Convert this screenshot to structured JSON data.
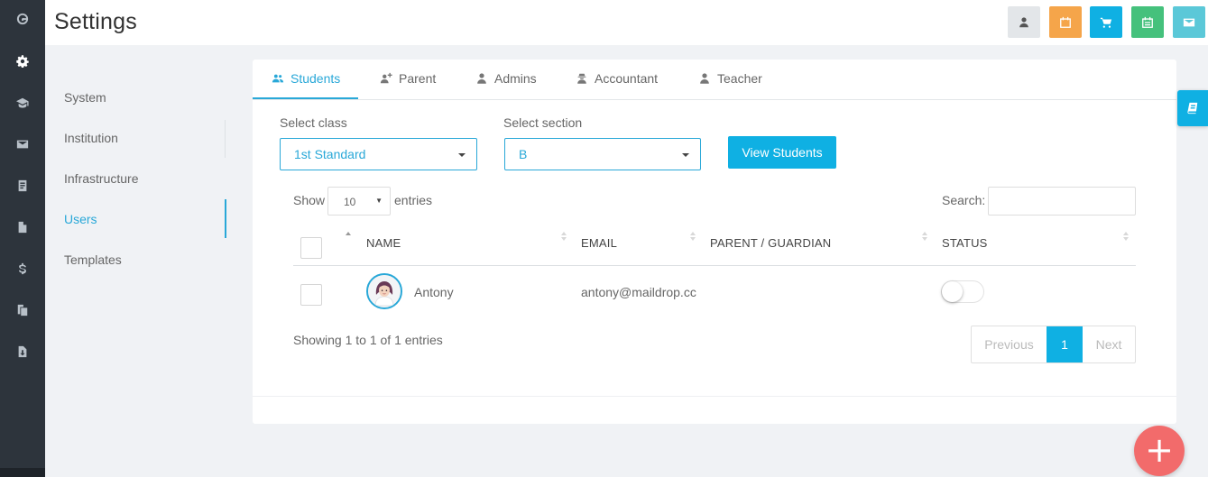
{
  "app": {
    "title": "Settings"
  },
  "rail": {
    "icons": [
      "dashboard-icon",
      "gear-icon",
      "graduation-cap-icon",
      "envelope-icon",
      "book-icon",
      "file-icon",
      "dollar-icon",
      "copy-icon",
      "download-file-icon"
    ],
    "active": "gear-icon"
  },
  "header_buttons": [
    {
      "icon": "user-icon",
      "color": "#e3e6e9"
    },
    {
      "icon": "calendar-icon",
      "color": "#f5a54a"
    },
    {
      "icon": "shopping-cart-icon",
      "color": "#0fb0e3"
    },
    {
      "icon": "calendar-list-icon",
      "color": "#45c17c"
    },
    {
      "icon": "mail-icon",
      "color": "#5bc8d8"
    }
  ],
  "submenu": {
    "items": [
      {
        "label": "System"
      },
      {
        "label": "Institution"
      },
      {
        "label": "Infrastructure"
      },
      {
        "label": "Users"
      },
      {
        "label": "Templates"
      }
    ],
    "active": "Users"
  },
  "tabs": [
    {
      "label": "Students",
      "icon": "users-icon"
    },
    {
      "label": "Parent",
      "icon": "user-plus-icon"
    },
    {
      "label": "Admins",
      "icon": "user-icon"
    },
    {
      "label": "Accountant",
      "icon": "user-secret-icon"
    },
    {
      "label": "Teacher",
      "icon": "user-icon"
    }
  ],
  "active_tab": "Students",
  "filters": {
    "class_label": "Select class",
    "class_value": "1st Standard",
    "section_label": "Select section",
    "section_value": "B",
    "view_button": "View Students"
  },
  "table": {
    "show_label": "Show",
    "page_length": "10",
    "entries_label": "entries",
    "search_label": "Search:",
    "search_value": "",
    "columns": [
      "NAME",
      "EMAIL",
      "PARENT / GUARDIAN",
      "STATUS"
    ],
    "rows": [
      {
        "name": "Antony",
        "email": "antony@maildrop.cc",
        "parent": "",
        "status_active": false
      }
    ],
    "info": "Showing 1 to 1 of 1 entries",
    "pagination": {
      "previous": "Previous",
      "current": "1",
      "next": "Next"
    }
  },
  "colors": {
    "accent": "#0fb0e3",
    "fab": "#f26b6b",
    "sidebar": "#2d343c"
  },
  "fab": {
    "label": "+"
  }
}
